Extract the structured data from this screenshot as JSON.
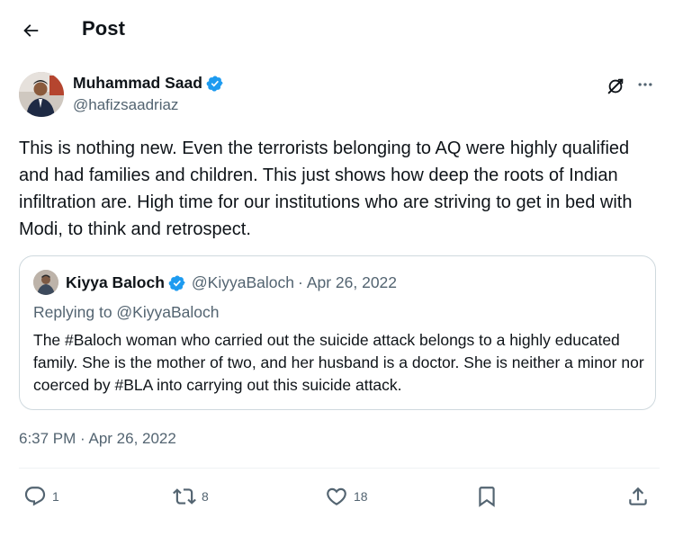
{
  "header": {
    "title": "Post"
  },
  "tweet": {
    "author_name": "Muhammad Saad",
    "author_handle": "@hafizsaadriaz",
    "text": "This is nothing new. Even the terrorists belonging to AQ were highly qualified and had families and children. This just shows how deep the roots of Indian infiltration are. High time for our institutions who are striving to get in bed with Modi, to think and retrospect.",
    "timestamp": "6:37 PM · Apr 26, 2022"
  },
  "quote": {
    "author_name": "Kiyya Baloch",
    "author_handle": "@KiyyaBaloch",
    "date": "Apr 26, 2022",
    "separator": "·",
    "replying_to": "Replying to @KiyyaBaloch",
    "text": "The #Baloch woman who carried out the suicide attack belongs to a highly educated family. She is the mother of two, and her husband is a doctor. She is neither a minor nor coerced by #BLA into carrying out this suicide attack."
  },
  "actions": {
    "replies": "1",
    "reposts": "8",
    "likes": "18"
  },
  "colors": {
    "verified": "#1d9bf0",
    "text_primary": "#0f1419",
    "text_secondary": "#536471",
    "border": "#cfd9de"
  },
  "icons": [
    "back-arrow-icon",
    "verified-badge-icon",
    "grok-icon",
    "more-icon",
    "reply-icon",
    "repost-icon",
    "like-icon",
    "bookmark-icon",
    "share-icon"
  ]
}
